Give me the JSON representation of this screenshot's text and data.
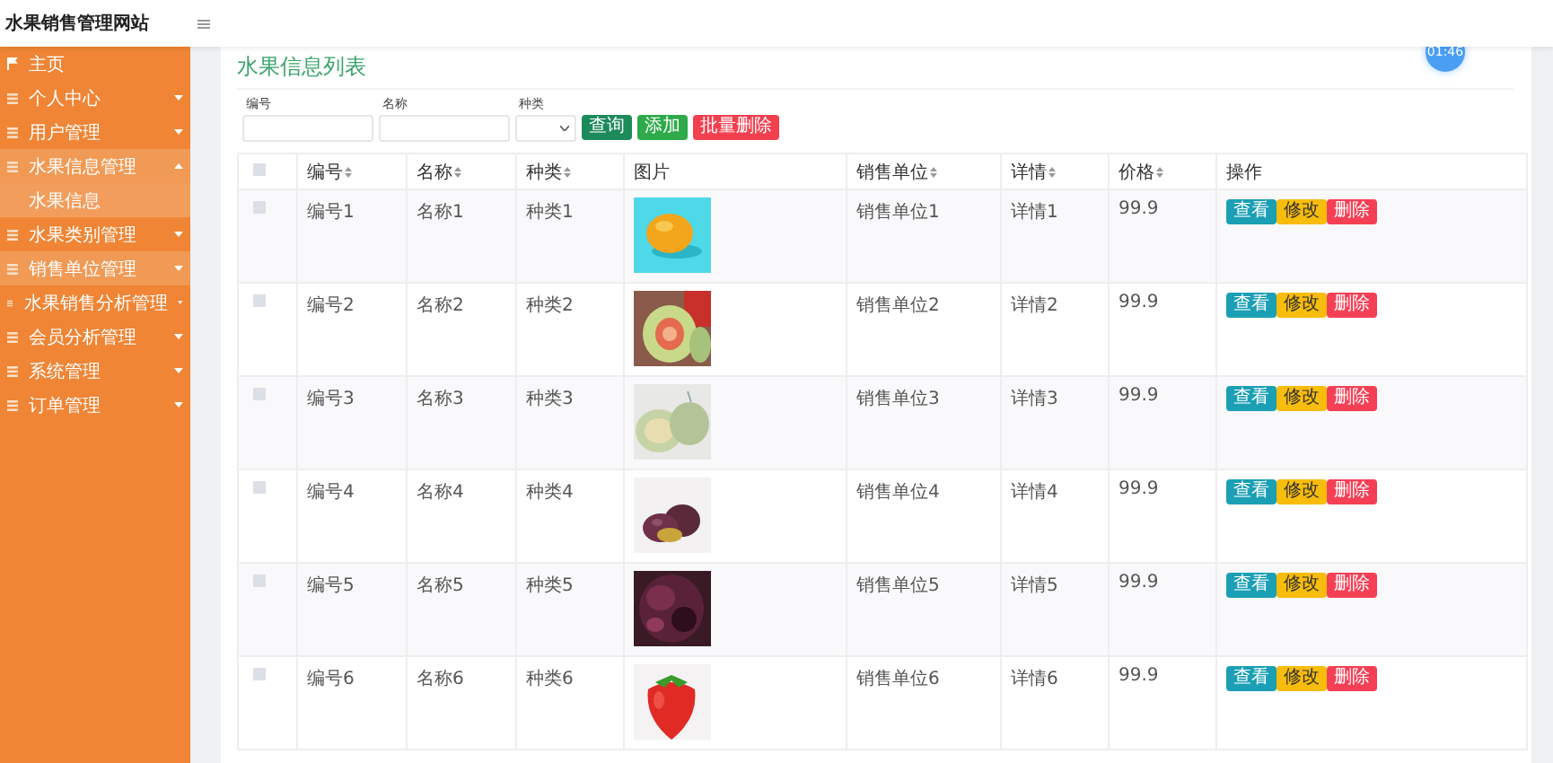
{
  "site_title": "水果销售管理网站",
  "timer": "01:46",
  "sidebar": {
    "items": [
      {
        "label": "主页",
        "kind": "home",
        "expanded": false,
        "hovered": false
      },
      {
        "label": "个人中心",
        "kind": "menu",
        "expanded": false,
        "hovered": false
      },
      {
        "label": "用户管理",
        "kind": "menu",
        "expanded": false,
        "hovered": false
      },
      {
        "label": "水果信息管理",
        "kind": "menu",
        "expanded": true,
        "hovered": false,
        "children": [
          {
            "label": "水果信息"
          }
        ]
      },
      {
        "label": "水果类别管理",
        "kind": "menu",
        "expanded": false,
        "hovered": false
      },
      {
        "label": "销售单位管理",
        "kind": "menu",
        "expanded": false,
        "hovered": true
      },
      {
        "label": "水果销售分析管理",
        "kind": "menu",
        "expanded": false,
        "hovered": false
      },
      {
        "label": "会员分析管理",
        "kind": "menu",
        "expanded": false,
        "hovered": false
      },
      {
        "label": "系统管理",
        "kind": "menu",
        "expanded": false,
        "hovered": false
      },
      {
        "label": "订单管理",
        "kind": "menu",
        "expanded": false,
        "hovered": false
      }
    ]
  },
  "page_title": "水果信息列表",
  "search": {
    "fields": [
      {
        "label": "编号",
        "kind": "text"
      },
      {
        "label": "名称",
        "kind": "text"
      },
      {
        "label": "种类",
        "kind": "select"
      }
    ],
    "buttons": [
      {
        "label": "查询",
        "kind": "query"
      },
      {
        "label": "添加",
        "kind": "add"
      },
      {
        "label": "批量删除",
        "kind": "delete"
      }
    ]
  },
  "table": {
    "select_all_checked": false,
    "columns": [
      {
        "label": "编号",
        "sortable": true
      },
      {
        "label": "名称",
        "sortable": true
      },
      {
        "label": "种类",
        "sortable": true
      },
      {
        "label": "图片",
        "sortable": false
      },
      {
        "label": "销售单位",
        "sortable": true
      },
      {
        "label": "详情",
        "sortable": true
      },
      {
        "label": "价格",
        "sortable": true
      },
      {
        "label": "操作",
        "sortable": false
      }
    ],
    "rows": [
      {
        "checked": false,
        "cells": [
          "编号1",
          "名称1",
          "种类1",
          "",
          "销售单位1",
          "详情1",
          "99.9"
        ],
        "image": {
          "kind": "picture"
        },
        "actions": [
          "查看",
          "修改",
          "删除"
        ]
      },
      {
        "checked": false,
        "cells": [
          "编号2",
          "名称2",
          "种类2",
          "",
          "销售单位2",
          "详情2",
          "99.9"
        ],
        "image": {
          "kind": "picture"
        },
        "actions": [
          "查看",
          "修改",
          "删除"
        ]
      },
      {
        "checked": false,
        "cells": [
          "编号3",
          "名称3",
          "种类3",
          "",
          "销售单位3",
          "详情3",
          "99.9"
        ],
        "image": {
          "kind": "picture"
        },
        "actions": [
          "查看",
          "修改",
          "删除"
        ]
      },
      {
        "checked": false,
        "cells": [
          "编号4",
          "名称4",
          "种类4",
          "",
          "销售单位4",
          "详情4",
          "99.9"
        ],
        "image": {
          "kind": "picture"
        },
        "actions": [
          "查看",
          "修改",
          "删除"
        ]
      },
      {
        "checked": false,
        "cells": [
          "编号5",
          "名称5",
          "种类5",
          "",
          "销售单位5",
          "详情5",
          "99.9"
        ],
        "image": {
          "kind": "picture"
        },
        "actions": [
          "查看",
          "修改",
          "删除"
        ]
      },
      {
        "checked": false,
        "cells": [
          "编号6",
          "名称6",
          "种类6",
          "",
          "销售单位6",
          "详情6",
          "99.9"
        ],
        "image": {
          "kind": "picture"
        },
        "actions": [
          "查看",
          "修改",
          "删除"
        ]
      }
    ]
  }
}
